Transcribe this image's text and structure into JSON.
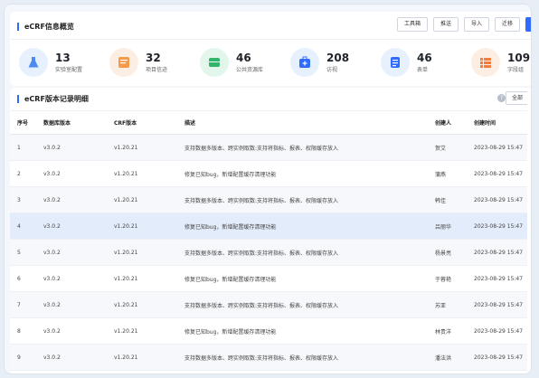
{
  "overview": {
    "title": "eCRF信息概览",
    "toolbar": [
      "工具箱",
      "推送",
      "导入",
      "迁移"
    ],
    "stats": [
      {
        "value": "13",
        "label": "实验室配置",
        "icon": "flask-icon",
        "bg": "#e7f0fd",
        "color": "#4d8bf0"
      },
      {
        "value": "32",
        "label": "项目信迹",
        "icon": "project-icon",
        "bg": "#fdeee3",
        "color": "#f39b4b"
      },
      {
        "value": "46",
        "label": "公共资源库",
        "icon": "database-icon",
        "bg": "#e3f6ec",
        "color": "#34b36b"
      },
      {
        "value": "208",
        "label": "访视",
        "icon": "medical-kit-icon",
        "bg": "#e7f0fd",
        "color": "#2f6bff"
      },
      {
        "value": "46",
        "label": "表单",
        "icon": "form-icon",
        "bg": "#e7f0fd",
        "color": "#2f6bff"
      },
      {
        "value": "109",
        "label": "字段组",
        "icon": "field-group-icon",
        "bg": "#fdeee3",
        "color": "#f27d3d"
      }
    ]
  },
  "versions": {
    "title": "eCRF版本记录明细",
    "help_icon": "?",
    "filter_label": "全部",
    "columns": [
      "序号",
      "数据库版本",
      "CRF版本",
      "描述",
      "创建人",
      "创建时间"
    ],
    "rows": [
      {
        "no": "1",
        "db": "v3.0.2",
        "crf": "v1.20.21",
        "desc": "支持数据多版本、跨实例取数:支持将指标、报表、权限缓存放入",
        "creator": "贺艾",
        "time": "2023-08-29 15:47"
      },
      {
        "no": "2",
        "db": "v3.0.2",
        "crf": "v1.20.21",
        "desc": "修复已知bug，新增配置缓存清理功能",
        "creator": "蒲燕",
        "time": "2023-08-29 15:47"
      },
      {
        "no": "3",
        "db": "v3.0.2",
        "crf": "v1.20.21",
        "desc": "支持数据多版本、跨实例取数:支持将指标、报表、权限缓存放入",
        "creator": "韩佳",
        "time": "2023-08-29 15:47"
      },
      {
        "no": "4",
        "db": "v3.0.2",
        "crf": "v1.20.21",
        "desc": "修复已知bug，新增配置缓存清理功能",
        "creator": "吕丽华",
        "time": "2023-08-29 15:47"
      },
      {
        "no": "5",
        "db": "v3.0.2",
        "crf": "v1.20.21",
        "desc": "支持数据多版本、跨实例取数:支持将指标、报表、权限缓存放入",
        "creator": "杨景亮",
        "time": "2023-08-29 15:47"
      },
      {
        "no": "6",
        "db": "v3.0.2",
        "crf": "v1.20.21",
        "desc": "修复已知bug，新增配置缓存清理功能",
        "creator": "于蓉艳",
        "time": "2023-08-29 15:47"
      },
      {
        "no": "7",
        "db": "v3.0.2",
        "crf": "v1.20.21",
        "desc": "支持数据多版本、跨实例取数:支持将指标、报表、权限缓存放入",
        "creator": "苏亚",
        "time": "2023-08-29 15:47"
      },
      {
        "no": "8",
        "db": "v3.0.2",
        "crf": "v1.20.21",
        "desc": "修复已知bug，新增配置缓存清理功能",
        "creator": "林贵洋",
        "time": "2023-08-29 15:47"
      },
      {
        "no": "9",
        "db": "v3.0.2",
        "crf": "v1.20.21",
        "desc": "支持数据多版本、跨实例取数:支持将指标、报表、权限缓存放入",
        "creator": "潘法洪",
        "time": "2023-08-29 15:47"
      }
    ],
    "highlight_row": 4
  }
}
